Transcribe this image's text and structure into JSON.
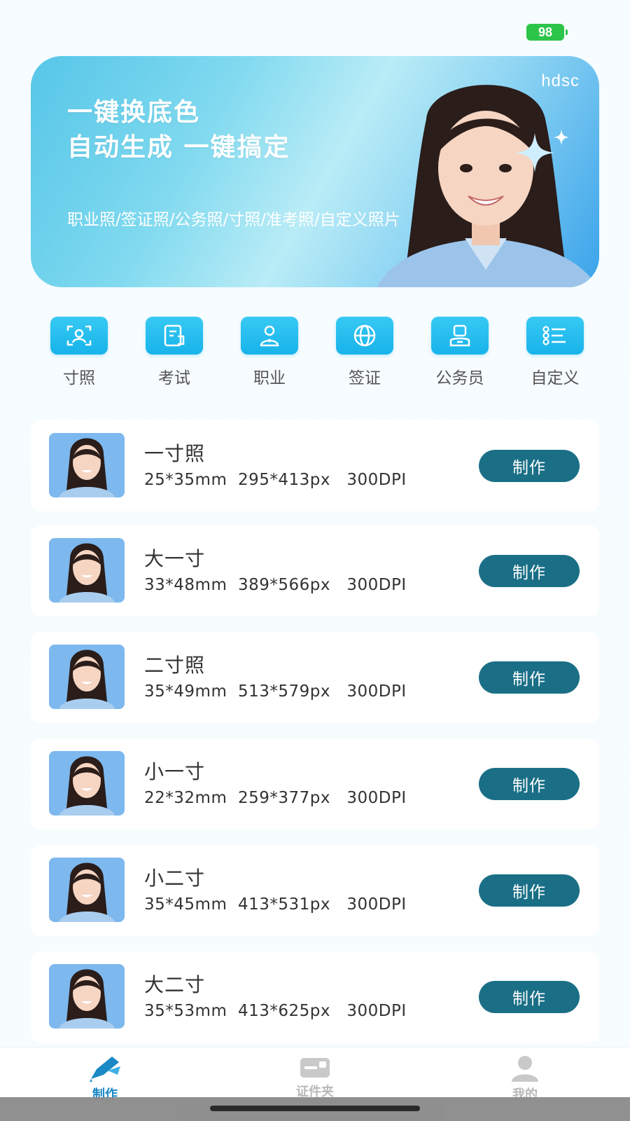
{
  "status_bar": {
    "battery": "98"
  },
  "banner": {
    "brand": "hdsc",
    "title_line1": "一键换底色",
    "title_line2": "自动生成 一键搞定",
    "subtitle": "职业照/签证照/公务照/寸照/准考照/自定义照片"
  },
  "categories": [
    {
      "label": "寸照",
      "icon": "portrait-frame-icon"
    },
    {
      "label": "考试",
      "icon": "exam-doc-icon"
    },
    {
      "label": "职业",
      "icon": "professional-person-icon"
    },
    {
      "label": "签证",
      "icon": "globe-icon"
    },
    {
      "label": "公务员",
      "icon": "civil-servant-icon"
    },
    {
      "label": "自定义",
      "icon": "custom-list-icon"
    }
  ],
  "photo_sizes": [
    {
      "name": "一寸照",
      "spec": "25*35mm  295*413px   300DPI",
      "action": "制作"
    },
    {
      "name": "大一寸",
      "spec": "33*48mm  389*566px   300DPI",
      "action": "制作"
    },
    {
      "name": "二寸照",
      "spec": "35*49mm  513*579px   300DPI",
      "action": "制作"
    },
    {
      "name": "小一寸",
      "spec": "22*32mm  259*377px   300DPI",
      "action": "制作"
    },
    {
      "name": "小二寸",
      "spec": "35*45mm  413*531px   300DPI",
      "action": "制作"
    },
    {
      "name": "大二寸",
      "spec": "35*53mm  413*625px   300DPI",
      "action": "制作"
    }
  ],
  "bottom_nav": [
    {
      "label": "制作",
      "active": true,
      "icon": "pen-make-icon"
    },
    {
      "label": "证件夹",
      "active": false,
      "icon": "id-card-folder-icon"
    },
    {
      "label": "我的",
      "active": false,
      "icon": "user-profile-icon"
    }
  ],
  "colors": {
    "accent": "#1a6f86",
    "icon_tile": "#1fb7ec",
    "nav_active": "#1a89c6",
    "battery": "#2dc44a"
  }
}
